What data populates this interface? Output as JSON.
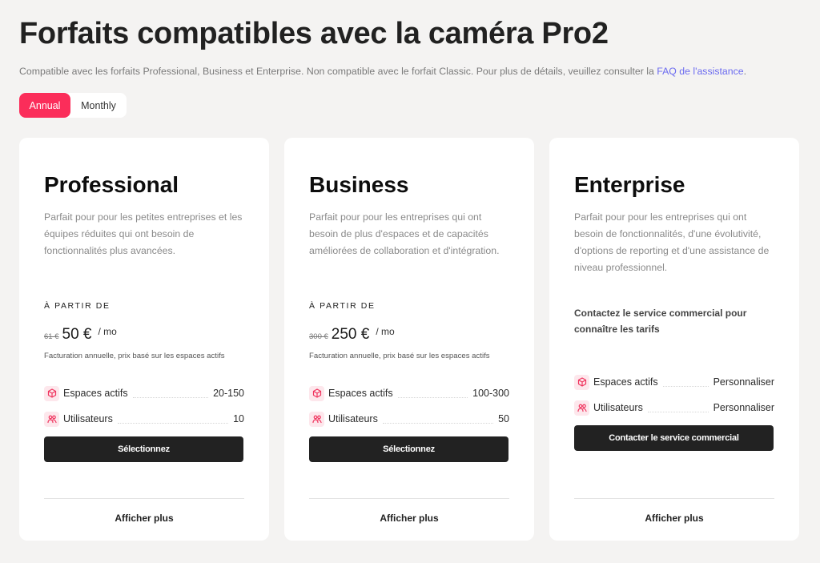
{
  "header": {
    "title": "Forfaits compatibles avec la caméra Pro2",
    "subtitle_text": "Compatible avec les forfaits Professional, Business et Enterprise. Non compatible avec le forfait Classic. Pour plus de détails, veuillez consulter la ",
    "subtitle_link": "FAQ de l'assistance",
    "subtitle_end": "."
  },
  "billing_toggle": {
    "options": [
      "Annual",
      "Monthly"
    ],
    "selected": "Annual",
    "accent_color": "#fb2d5a"
  },
  "plans": [
    {
      "name": "Professional",
      "description": "Parfait pour pour les petites entreprises et les équipes réduites qui ont besoin de fonctionnalités plus avancées.",
      "from_label": "À PARTIR DE",
      "old_price": "61 €",
      "price": "50 €",
      "per": "/ mo",
      "billing_note": "Facturation annuelle, prix basé sur les espaces actifs",
      "features": [
        {
          "icon": "cube-icon",
          "label": "Espaces actifs",
          "value": "20-150"
        },
        {
          "icon": "users-icon",
          "label": "Utilisateurs",
          "value": "10"
        }
      ],
      "button": "Sélectionnez",
      "more": "Afficher plus"
    },
    {
      "name": "Business",
      "description": "Parfait pour pour les entreprises qui ont besoin de plus d'espaces et de capacités améliorées de collaboration et d'intégration.",
      "from_label": "À PARTIR DE",
      "old_price": "300 €",
      "price": "250 €",
      "per": "/ mo",
      "billing_note": "Facturation annuelle, prix basé sur les espaces actifs",
      "features": [
        {
          "icon": "cube-icon",
          "label": "Espaces actifs",
          "value": "100-300"
        },
        {
          "icon": "users-icon",
          "label": "Utilisateurs",
          "value": "50"
        }
      ],
      "button": "Sélectionnez",
      "more": "Afficher plus"
    },
    {
      "name": "Enterprise",
      "description": "Parfait pour pour les entreprises qui ont besoin de fonctionnalités, d'une évolutivité, d'options de reporting et d'une assistance de niveau professionnel.",
      "contact_text": "Contactez le service commercial pour connaître les tarifs",
      "features": [
        {
          "icon": "cube-icon",
          "label": "Espaces actifs",
          "value": "Personnaliser"
        },
        {
          "icon": "users-icon",
          "label": "Utilisateurs",
          "value": "Personnaliser"
        }
      ],
      "button": "Contacter le service commercial",
      "more": "Afficher plus"
    }
  ]
}
